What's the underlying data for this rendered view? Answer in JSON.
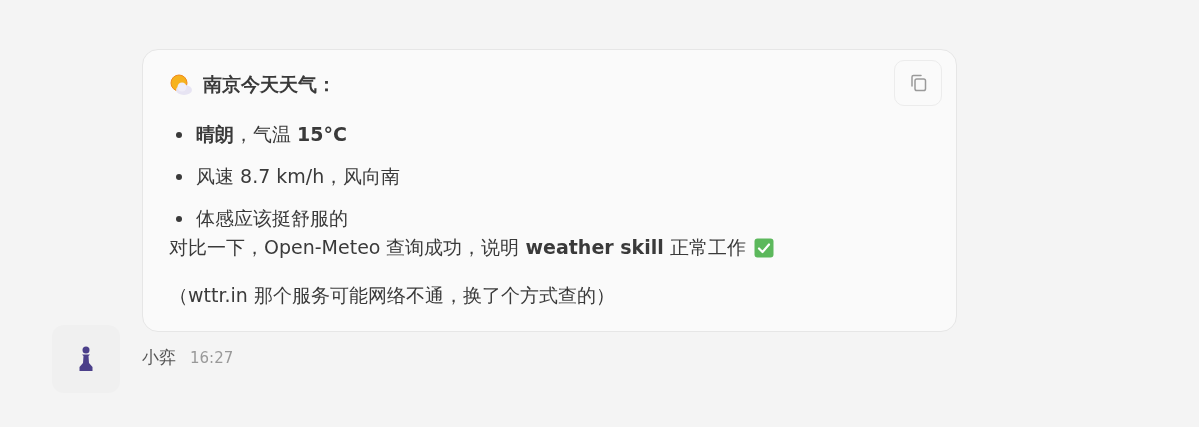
{
  "message": {
    "heading": "南京今天天气：",
    "bullets": [
      "**晴朗**，气温 **15°C**",
      "风速 8.7 km/h，风向南",
      "体感应该挺舒服的"
    ],
    "summary": "对比一下，Open-Meteo 查询成功，说明 **weather skill** 正常工作",
    "note": "（wttr.in 那个服务可能网络不通，换了个方式查的）",
    "sender": "小弈",
    "time": "16:27"
  }
}
